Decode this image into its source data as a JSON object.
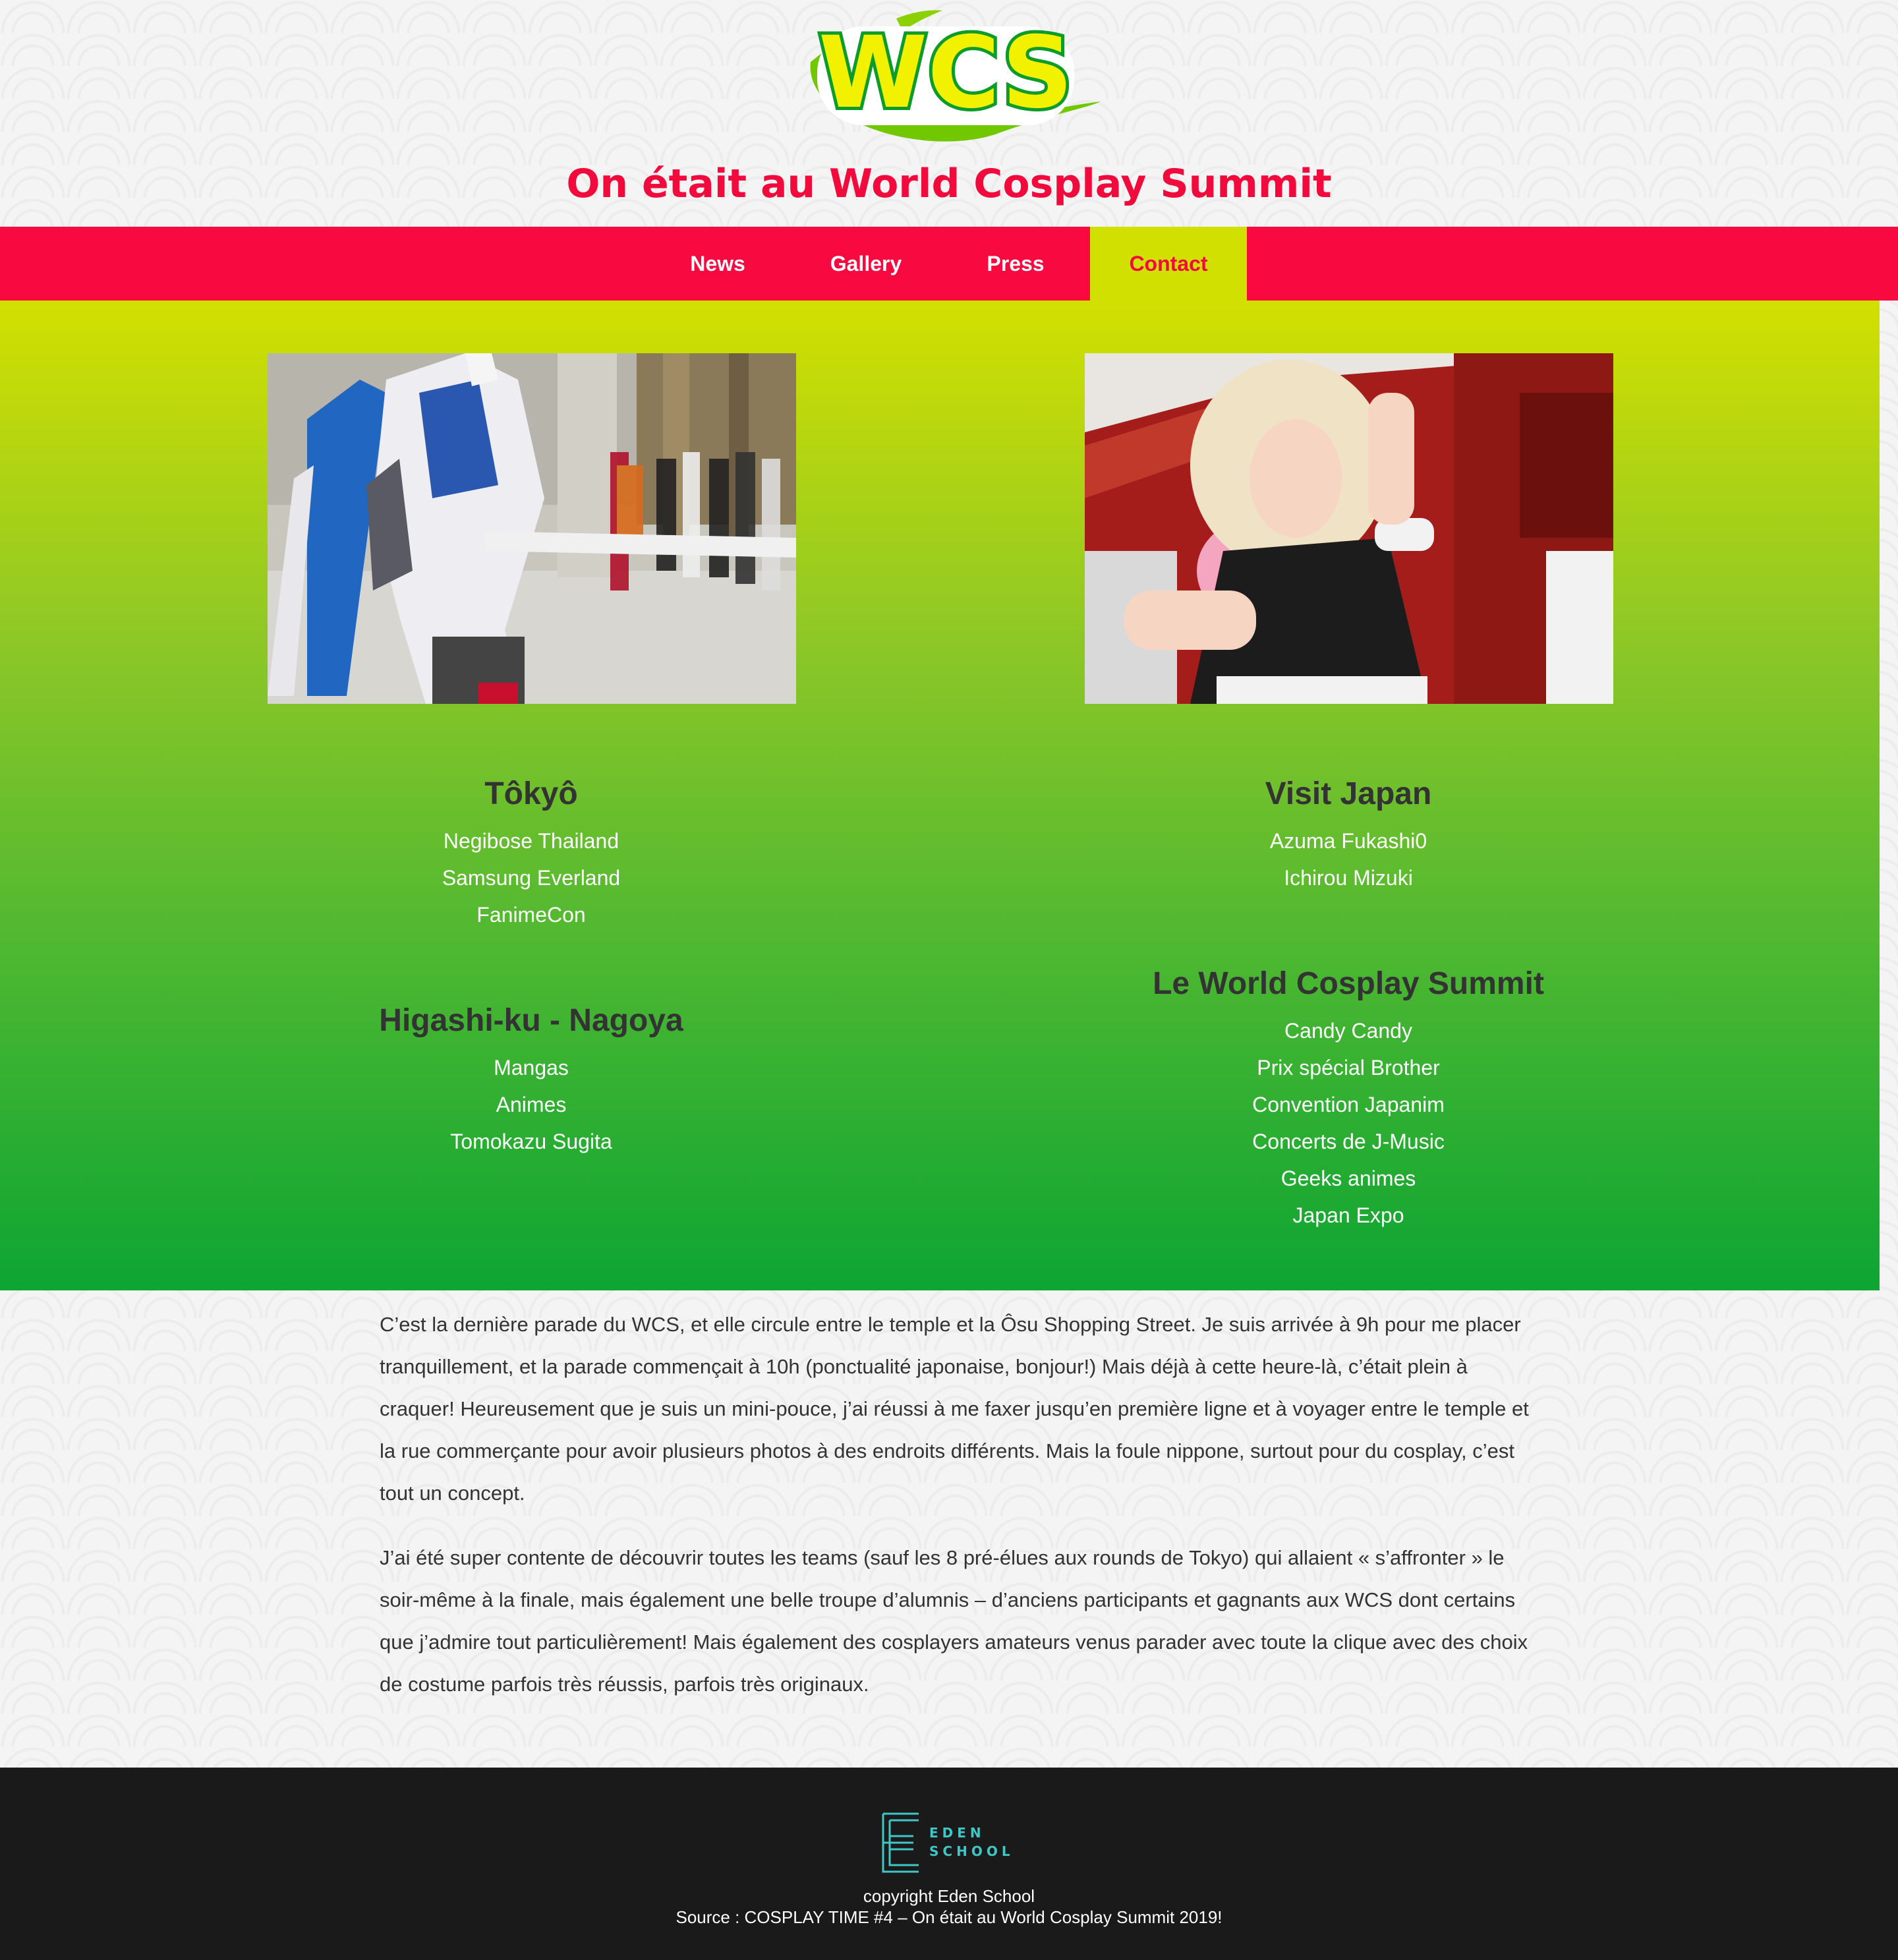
{
  "header": {
    "logo_text": "WCS",
    "title": "On était au World Cosplay Summit"
  },
  "nav": {
    "items": [
      {
        "label": "News",
        "active": false
      },
      {
        "label": "Gallery",
        "active": false
      },
      {
        "label": "Press",
        "active": false
      },
      {
        "label": "Contact",
        "active": true
      }
    ]
  },
  "hero": {
    "left_column": {
      "sections": [
        {
          "heading": "Tôkyô",
          "items": [
            "Negibose Thailand",
            "Samsung Everland",
            "FanimeCon"
          ]
        },
        {
          "heading": "Higashi-ku - Nagoya",
          "items": [
            "Mangas",
            "Animes",
            "Tomokazu Sugita"
          ]
        }
      ]
    },
    "right_column": {
      "sections": [
        {
          "heading": "Visit Japan",
          "items": [
            "Azuma Fukashi0",
            "Ichirou Mizuki"
          ]
        },
        {
          "heading": "Le World Cosplay Summit",
          "items": [
            "Candy Candy",
            "Prix spécial Brother",
            "Convention Japanim",
            "Concerts de J-Music",
            "Geeks animes",
            "Japan Expo"
          ]
        }
      ]
    }
  },
  "article": {
    "paragraphs": [
      "C’est la dernière parade du WCS, et elle circule entre le temple et la Ôsu Shopping Street. Je suis arrivée à 9h pour me placer tranquillement, et la parade commençait à 10h (ponctualité japonaise, bonjour!) Mais déjà à cette heure-là, c’était plein à craquer! Heureusement que je suis un mini-pouce, j’ai réussi à me faxer jusqu’en première ligne et à voyager entre le temple et la rue commerçante pour avoir plusieurs photos à des endroits différents. Mais la foule nippone, surtout pour du cosplay, c’est tout un concept.",
      "J’ai été super contente de découvrir toutes les teams (sauf les 8 pré-élues aux rounds de Tokyo) qui allaient « s’affronter » le soir-même à la finale, mais également une belle troupe d’alumnis – d’anciens participants et gagnants aux WCS dont certains que j’admire tout particulièrement! Mais également des cosplayers amateurs venus parader avec toute la clique avec des choix de costume parfois très réussis, parfois très originaux."
    ]
  },
  "footer": {
    "logo_line1": "EDEN",
    "logo_line2": "SCHOOL",
    "copyright": "copyright Eden School",
    "source": "Source : COSPLAY TIME #4 – On était au World Cosplay Summit 2019!"
  },
  "colors": {
    "brand_red": "#f8093f",
    "brand_yellow": "#d1e000",
    "brand_green": "#0da533",
    "footer_bg": "#1a1a1a",
    "footer_accent": "#3fc7c7"
  }
}
